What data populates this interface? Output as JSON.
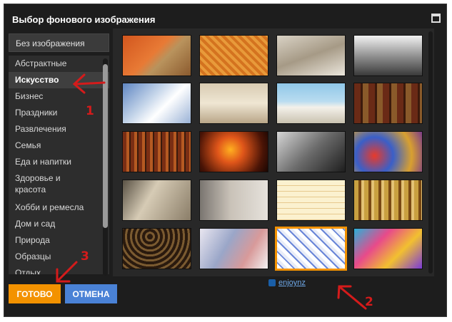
{
  "dialog": {
    "title": "Выбор фонового изображения"
  },
  "sidebar": {
    "no_image": "Без изображения",
    "categories": [
      "Абстрактные",
      "Искусство",
      "Бизнес",
      "Праздники",
      "Развлечения",
      "Семья",
      "Еда и напитки",
      "Здоровье и красота",
      "Хобби и ремесла",
      "Дом и сад",
      "Природа",
      "Образцы",
      "Отдых"
    ],
    "selected": "Искусство"
  },
  "images": {
    "credit": "enjoynz",
    "selected_index": 17,
    "count": 20
  },
  "buttons": {
    "done": "ГОТОВО",
    "cancel": "ОТМЕНА"
  },
  "annotations": {
    "one": "1",
    "two": "2",
    "three": "3"
  },
  "colors": {
    "accent": "#f39200",
    "cancel": "#4a82d6",
    "annotation": "#d41b1b"
  }
}
